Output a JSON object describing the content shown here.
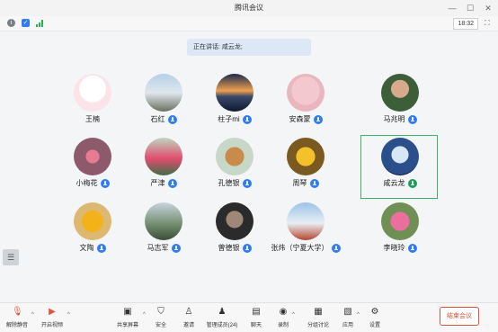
{
  "window": {
    "title": "腾讯会议"
  },
  "status": {
    "time": "18:32"
  },
  "speaking": {
    "label": "正在讲话:",
    "name": "咸云龙;"
  },
  "participants": [
    {
      "name": "王楠",
      "mic": false,
      "avatar": "cartoon-avatar"
    },
    {
      "name": "石红",
      "mic": true,
      "avatar": "outdoor-photo-avatar"
    },
    {
      "name": "柱子mi",
      "mic": true,
      "avatar": "sunset-lake-avatar"
    },
    {
      "name": "安森蒙",
      "mic": true,
      "avatar": "baby-photo-avatar"
    },
    {
      "name": "马兆明",
      "mic": true,
      "avatar": "man-portrait-avatar"
    },
    {
      "name": "小梅花",
      "mic": true,
      "avatar": "flower-avatar"
    },
    {
      "name": "严津",
      "mic": true,
      "avatar": "woman-red-dress-avatar"
    },
    {
      "name": "孔德银",
      "mic": true,
      "avatar": "deer-avatar"
    },
    {
      "name": "周琴",
      "mic": true,
      "avatar": "yellow-flower-avatar"
    },
    {
      "name": "咸云龙",
      "mic": true,
      "avatar": "earth-avatar",
      "speaking": true
    },
    {
      "name": "文陶",
      "mic": true,
      "avatar": "sunflower-avatar"
    },
    {
      "name": "马志军",
      "mic": true,
      "avatar": "landscape-avatar"
    },
    {
      "name": "曾德银",
      "mic": true,
      "avatar": "dark-portrait-avatar"
    },
    {
      "name": "张炜（宁夏大学）",
      "mic": true,
      "avatar": "person-sky-avatar"
    },
    {
      "name": "李晓玲",
      "mic": true,
      "avatar": "pink-flower-avatar"
    }
  ],
  "toolbar": {
    "unmute": "解除静音",
    "start_video": "开启视频",
    "share_screen": "共享屏幕",
    "security": "安全",
    "invite": "邀请",
    "members": "管理成员(24)",
    "chat": "聊天",
    "record": "录制",
    "breakout": "分组讨论",
    "apps": "应用",
    "settings": "设置",
    "end_meeting": "结束会议"
  },
  "colors": {
    "mic_blue": "#2f7cf6",
    "speaking_green": "#3cb56b",
    "end_red": "#e0533d"
  }
}
